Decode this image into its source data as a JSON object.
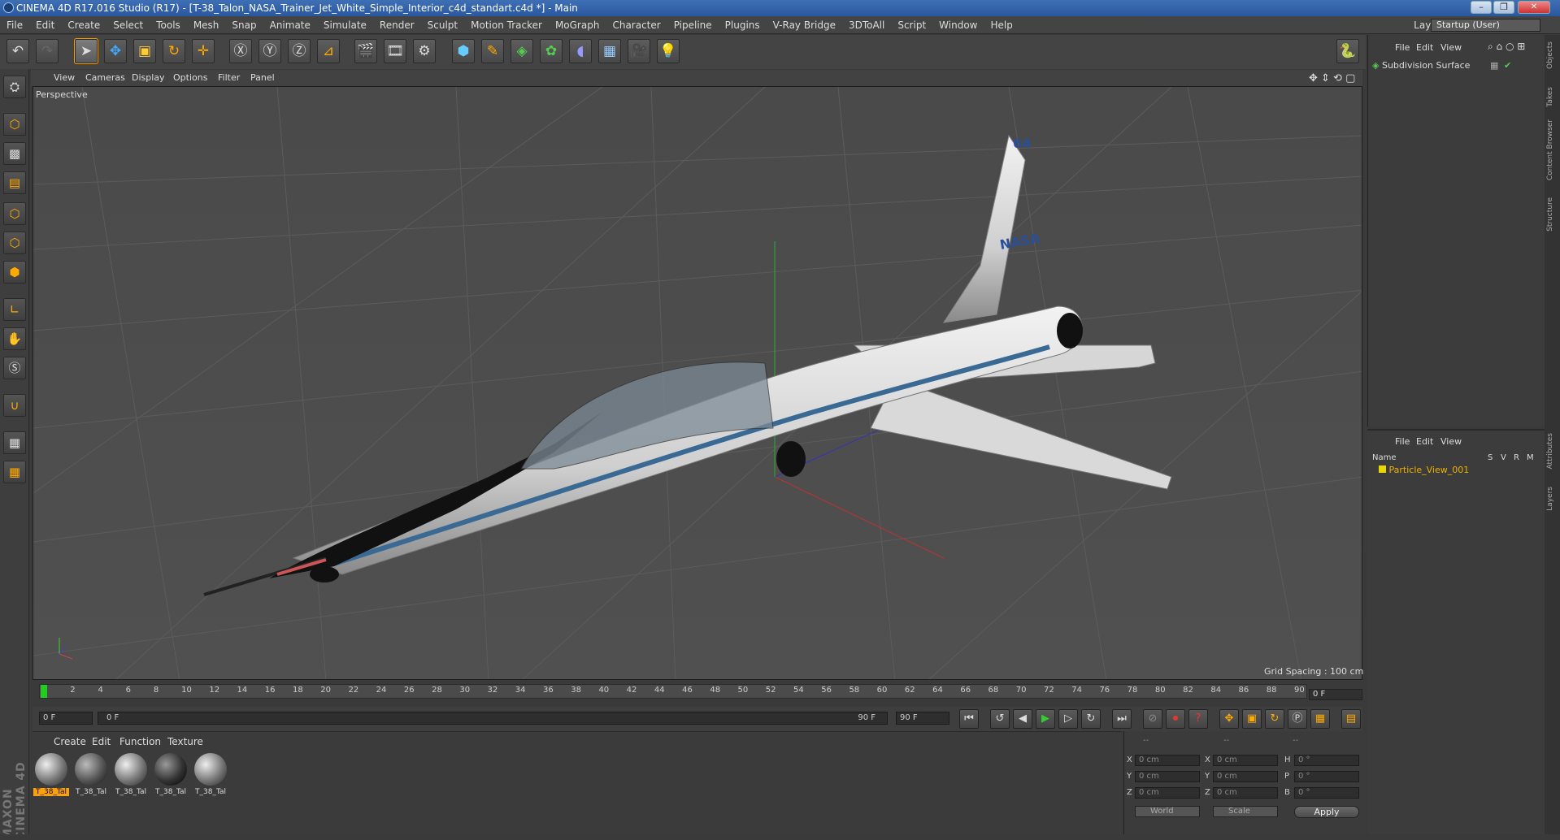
{
  "window": {
    "title": "CINEMA 4D R17.016 Studio (R17) - [T-38_Talon_NASA_Trainer_Jet_White_Simple_Interior_c4d_standart.c4d *] - Main",
    "min": "–",
    "max": "❐",
    "close": "✕"
  },
  "menubar": [
    "File",
    "Edit",
    "Create",
    "Select",
    "Tools",
    "Mesh",
    "Snap",
    "Animate",
    "Simulate",
    "Render",
    "Sculpt",
    "Motion Tracker",
    "MoGraph",
    "Character",
    "Pipeline",
    "Plugins",
    "V-Ray Bridge",
    "3DToAll",
    "Script",
    "Window",
    "Help"
  ],
  "layout": {
    "label": "Layout:",
    "value": "Startup (User)"
  },
  "viewport": {
    "menu": [
      "View",
      "Cameras",
      "Display",
      "Options",
      "Filter",
      "Panel"
    ],
    "label": "Perspective",
    "grid_spacing": "Grid Spacing : 100 cm"
  },
  "timeline": {
    "ticks": [
      "0",
      "2",
      "4",
      "6",
      "8",
      "10",
      "12",
      "14",
      "16",
      "18",
      "20",
      "22",
      "24",
      "26",
      "28",
      "30",
      "32",
      "34",
      "36",
      "38",
      "40",
      "42",
      "44",
      "46",
      "48",
      "50",
      "52",
      "54",
      "56",
      "58",
      "60",
      "62",
      "64",
      "66",
      "68",
      "70",
      "72",
      "74",
      "76",
      "78",
      "80",
      "82",
      "84",
      "86",
      "88",
      "90"
    ],
    "current_frame": "0 F",
    "start": "0 F",
    "range_start": "0 F",
    "range_end": "90 F",
    "end": "90 F"
  },
  "materials": {
    "menu": [
      "Create",
      "Edit",
      "Function",
      "Texture"
    ],
    "items": [
      "T_38_Tal",
      "T_38_Tal",
      "T_38_Tal",
      "T_38_Tal",
      "T_38_Tal"
    ]
  },
  "coords": {
    "header": [
      "--",
      "--",
      "--"
    ],
    "rows": [
      {
        "a": "X",
        "av": "0 cm",
        "b": "X",
        "bv": "0 cm",
        "c": "H",
        "cv": "0 °"
      },
      {
        "a": "Y",
        "av": "0 cm",
        "b": "Y",
        "bv": "0 cm",
        "c": "P",
        "cv": "0 °"
      },
      {
        "a": "Z",
        "av": "0 cm",
        "b": "Z",
        "bv": "0 cm",
        "c": "B",
        "cv": "0 °"
      }
    ],
    "space": "World",
    "mode": "Scale",
    "apply": "Apply"
  },
  "objects": {
    "menu": [
      "File",
      "Edit",
      "View"
    ],
    "items": [
      "Subdivision Surface"
    ]
  },
  "layers": {
    "menu": [
      "File",
      "Edit",
      "View"
    ],
    "columns": [
      "Name",
      "S",
      "V",
      "R",
      "M"
    ],
    "items": [
      "Particle_View_001"
    ]
  },
  "right_tabs": [
    "Objects",
    "Takes",
    "Content Browser",
    "Structure",
    "Attributes",
    "Layers"
  ],
  "brand": "MAXON CINEMA 4D"
}
